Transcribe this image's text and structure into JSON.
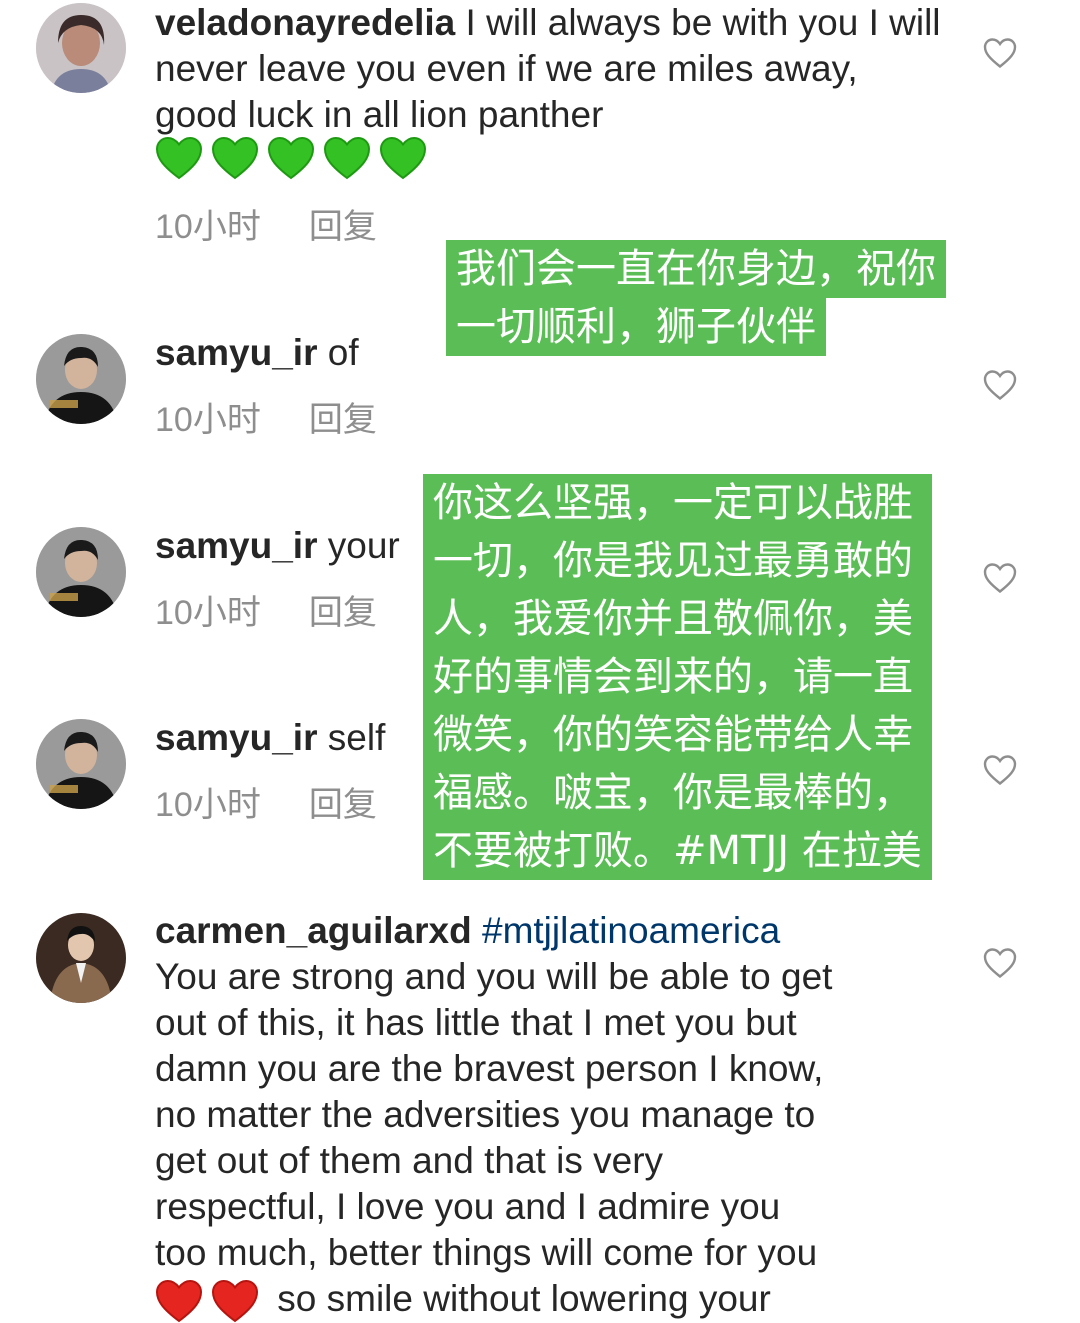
{
  "comments": [
    {
      "username": "veladonayredelia",
      "text": " I will always be with you I will never leave you even if we are miles away, good luck in all lion panther",
      "time": "10小时",
      "reply": "回复",
      "emojis": [
        "green-heart",
        "green-heart",
        "green-heart",
        "green-heart",
        "green-heart"
      ]
    },
    {
      "username": "samyu_ir",
      "text": " of",
      "time": "10小时",
      "reply": "回复"
    },
    {
      "username": "samyu_ir",
      "text": " your",
      "time": "10小时",
      "reply": "回复"
    },
    {
      "username": "samyu_ir",
      "text": " self",
      "time": "10小时",
      "reply": "回复"
    },
    {
      "username": "carmen_aguilarxd",
      "hashtag": "#mtjjlatinoamerica",
      "text_lines": [
        "You are strong and you will be able to get",
        "out of this, it has little that I met you but",
        "damn you are the bravest person I know,",
        "no matter the adversities you manage to",
        "get out of them and that is very",
        "respectful, I love you and I admire you",
        "too much, better things will come for you",
        "so smile without lowering your"
      ],
      "emojis": [
        "red-heart",
        "red-heart"
      ]
    }
  ],
  "translations": [
    {
      "lines": [
        "我们会一直在你身边，祝你",
        "一切顺利，狮子伙伴"
      ]
    },
    {
      "lines": [
        "你这么坚强，一定可以战胜",
        "一切，你是我见过最勇敢的",
        "人，我爱你并且敬佩你，美",
        "好的事情会到来的，请一直",
        "微笑，你的笑容能带给人幸",
        "福感。啵宝，你是最棒的，",
        "不要被打败。#MTJJ 在拉美"
      ]
    }
  ],
  "colors": {
    "overlay": "#5bbd56",
    "hashtag": "#00376b",
    "meta": "#8e8e8e"
  }
}
